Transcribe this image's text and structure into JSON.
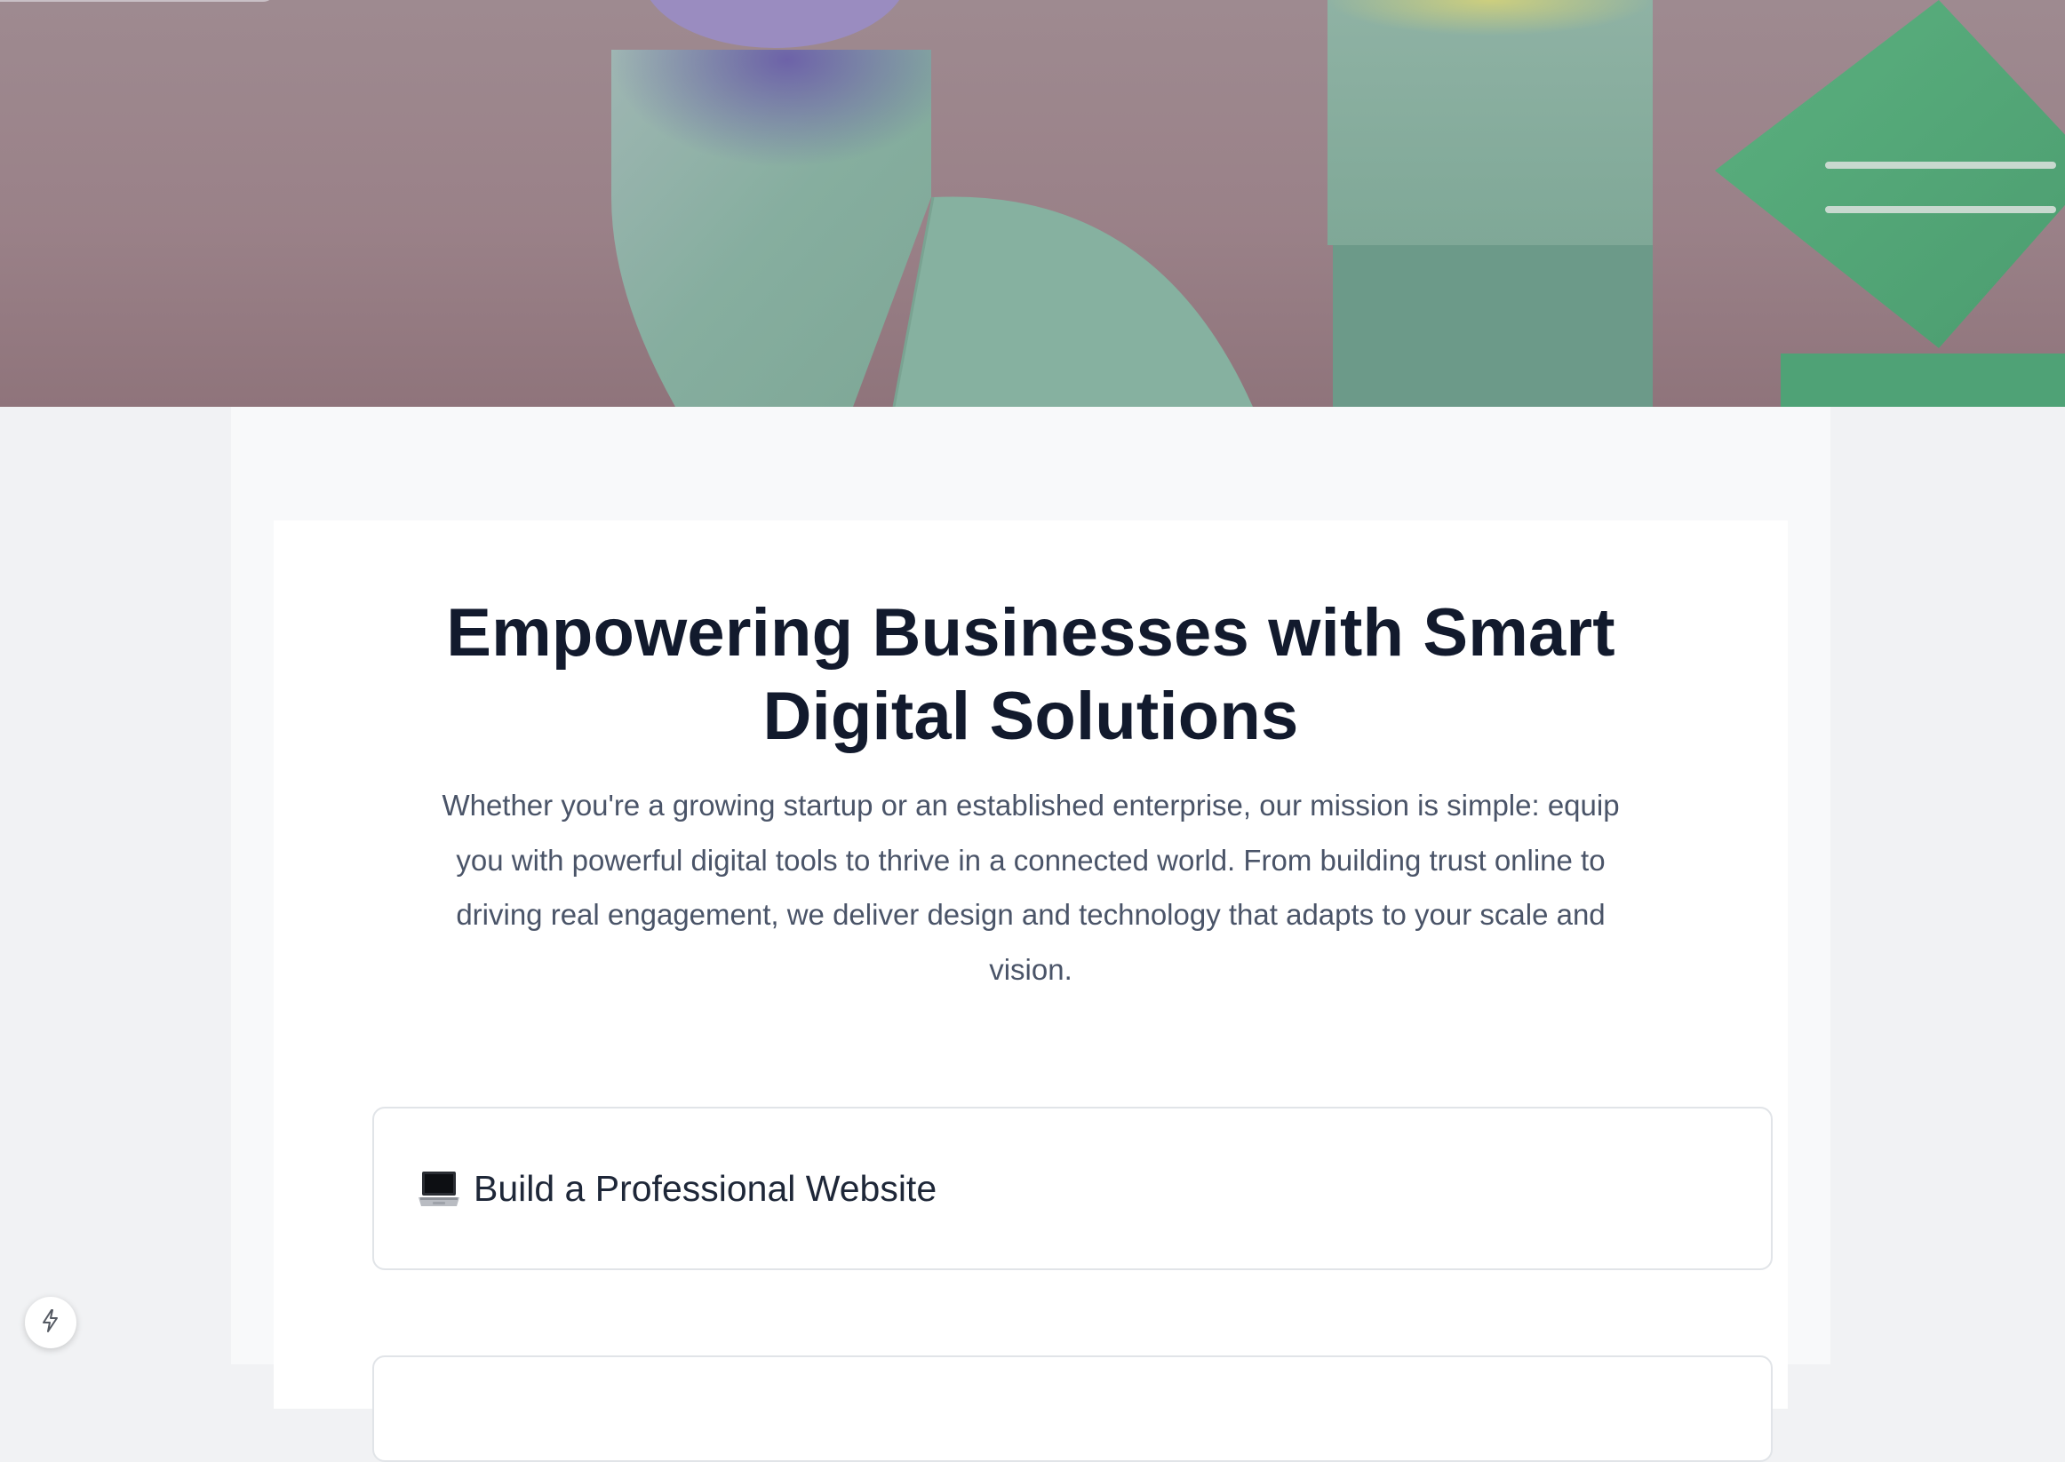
{
  "hero": {
    "image_alt": "abstract geometric shapes"
  },
  "main": {
    "headline_line1": "Empowering Businesses with Smart",
    "headline_line2": "Digital Solutions",
    "intro": "Whether you're a growing startup or an established enterprise, our mission is simple: equip you with powerful digital tools to thrive in a connected world. From building trust online to driving real engagement, we deliver design and technology that adapts to your scale and vision.",
    "features": [
      {
        "icon": "laptop-icon",
        "title": "Build a Professional Website"
      }
    ]
  },
  "colors": {
    "page_background": "#f1f2f4",
    "column_background": "#f8f9fa",
    "card_background": "#ffffff",
    "headline": "#121a2d",
    "body_text": "#4a5468",
    "card_border": "#e1e4e8",
    "hero_background": "#9a8188",
    "hero_shape_mint": "#88b1a2",
    "hero_shape_green": "#54a57a",
    "hero_shape_purple": "#9a8cc0"
  },
  "floating_button": {
    "icon": "lightning-bolt-icon"
  }
}
